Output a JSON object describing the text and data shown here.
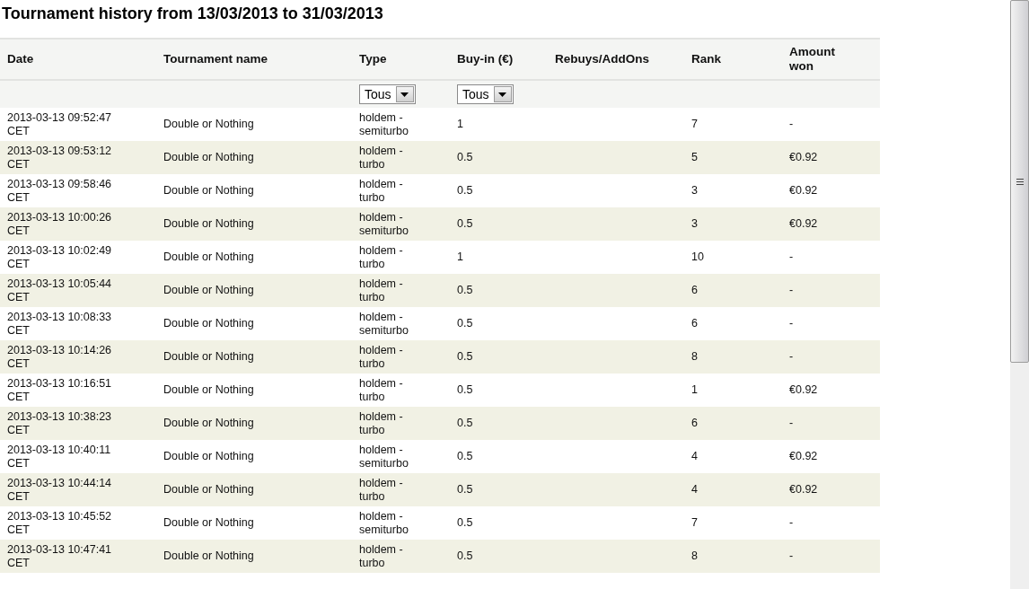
{
  "title": "Tournament history from 13/03/2013 to 31/03/2013",
  "table": {
    "columns": [
      {
        "label": "Date"
      },
      {
        "label": "Tournament name"
      },
      {
        "label": "Type",
        "filter": "Tous"
      },
      {
        "label": "Buy-in (€)",
        "filter": "Tous"
      },
      {
        "label": "Rebuys/AddOns"
      },
      {
        "label": "Rank"
      },
      {
        "label": "Amount won"
      }
    ],
    "rows": [
      {
        "date": "2013-03-13 09:52:47 CET",
        "name": "Double or Nothing",
        "type": "holdem - semiturbo",
        "buy_in": "1",
        "rank": "7",
        "amount_won": "-"
      },
      {
        "date": "2013-03-13 09:53:12 CET",
        "name": "Double or Nothing",
        "type": "holdem - turbo",
        "buy_in": "0.5",
        "rank": "5",
        "amount_won": "€0.92"
      },
      {
        "date": "2013-03-13 09:58:46 CET",
        "name": "Double or Nothing",
        "type": "holdem - turbo",
        "buy_in": "0.5",
        "rank": "3",
        "amount_won": "€0.92"
      },
      {
        "date": "2013-03-13 10:00:26 CET",
        "name": "Double or Nothing",
        "type": "holdem - semiturbo",
        "buy_in": "0.5",
        "rank": "3",
        "amount_won": "€0.92"
      },
      {
        "date": "2013-03-13 10:02:49 CET",
        "name": "Double or Nothing",
        "type": "holdem - turbo",
        "buy_in": "1",
        "rank": "10",
        "amount_won": "-"
      },
      {
        "date": "2013-03-13 10:05:44 CET",
        "name": "Double or Nothing",
        "type": "holdem - turbo",
        "buy_in": "0.5",
        "rank": "6",
        "amount_won": "-"
      },
      {
        "date": "2013-03-13 10:08:33 CET",
        "name": "Double or Nothing",
        "type": "holdem - semiturbo",
        "buy_in": "0.5",
        "rank": "6",
        "amount_won": "-"
      },
      {
        "date": "2013-03-13 10:14:26 CET",
        "name": "Double or Nothing",
        "type": "holdem - turbo",
        "buy_in": "0.5",
        "rank": "8",
        "amount_won": "-"
      },
      {
        "date": "2013-03-13 10:16:51 CET",
        "name": "Double or Nothing",
        "type": "holdem - turbo",
        "buy_in": "0.5",
        "rank": "1",
        "amount_won": "€0.92"
      },
      {
        "date": "2013-03-13 10:38:23 CET",
        "name": "Double or Nothing",
        "type": "holdem - turbo",
        "buy_in": "0.5",
        "rank": "6",
        "amount_won": "-"
      },
      {
        "date": "2013-03-13 10:40:11 CET",
        "name": "Double or Nothing",
        "type": "holdem - semiturbo",
        "buy_in": "0.5",
        "rank": "4",
        "amount_won": "€0.92"
      },
      {
        "date": "2013-03-13 10:44:14 CET",
        "name": "Double or Nothing",
        "type": "holdem - turbo",
        "buy_in": "0.5",
        "rank": "4",
        "amount_won": "€0.92"
      },
      {
        "date": "2013-03-13 10:45:52 CET",
        "name": "Double or Nothing",
        "type": "holdem - semiturbo",
        "buy_in": "0.5",
        "rank": "7",
        "amount_won": "-"
      },
      {
        "date": "2013-03-13 10:47:41 CET",
        "name": "Double or Nothing",
        "type": "holdem - turbo",
        "buy_in": "0.5",
        "rank": "8",
        "amount_won": "-"
      }
    ]
  }
}
